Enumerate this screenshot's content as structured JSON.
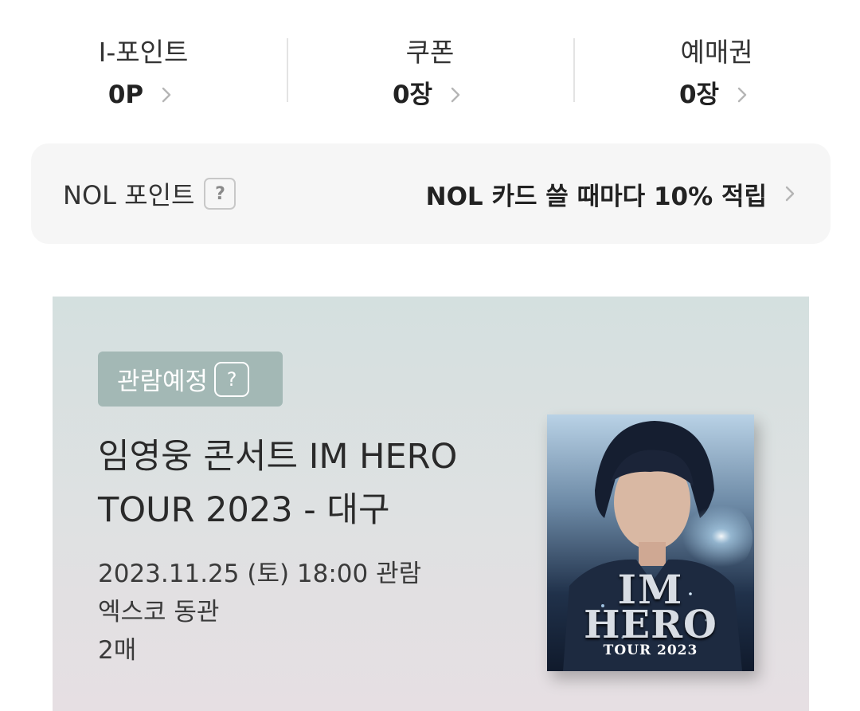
{
  "stats": [
    {
      "label": "I-포인트",
      "value": "0P"
    },
    {
      "label": "쿠폰",
      "value": "0장"
    },
    {
      "label": "예매권",
      "value": "0장"
    }
  ],
  "nol": {
    "label": "NOL 포인트",
    "help_glyph": "?",
    "promo": "NOL 카드 쓸 때마다 10% 적립"
  },
  "ticket": {
    "badge": "관람예정",
    "badge_help": "?",
    "title": "임영웅 콘서트 IM HERO TOUR 2023 - 대구",
    "date": "2023.11.25 (토)  18:00 관람",
    "venue": "엑스코 동관",
    "count": "2매",
    "poster": {
      "line1": "IM",
      "line2": "HERO",
      "line3": "TOUR 2023"
    }
  },
  "icons": {
    "stat_arrow": "chevron-right-icon",
    "help": "question-icon",
    "poster": "concert-poster-image"
  },
  "colors": {
    "badge_bg": "#a3b8b5",
    "nol_box_bg": "#f6f6f6",
    "ticket_bg_top": "#d4e0df",
    "ticket_bg_bottom": "#e6dfe3"
  }
}
